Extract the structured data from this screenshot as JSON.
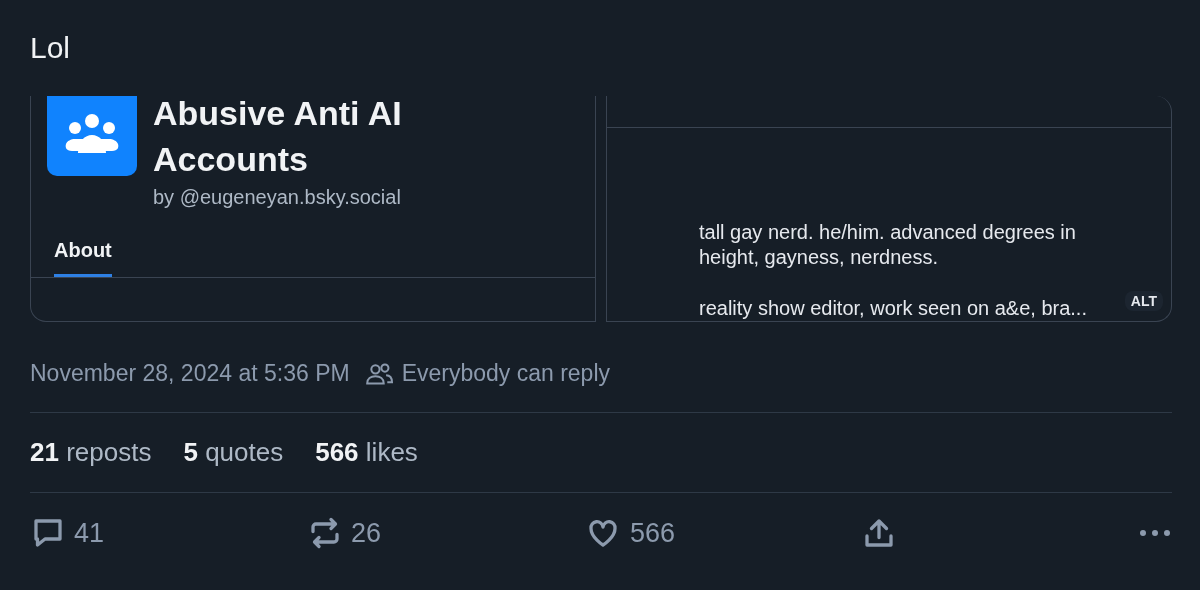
{
  "post": {
    "text": "Lol"
  },
  "images": [
    {
      "kind": "feed",
      "title": "Abusive Anti AI Accounts",
      "author": "by @eugeneyan.bsky.social",
      "tabs": [
        {
          "label": "About",
          "selected": true
        }
      ]
    },
    {
      "kind": "profile",
      "bio": [
        "tall gay nerd. he/him. advanced degrees in height, gayness, nerdness.",
        "reality show editor, work seen on a&e, bra..."
      ],
      "badge": "ALT"
    }
  ],
  "meta": {
    "timestamp": "November 28, 2024 at 5:36 PM",
    "reply_setting": "Everybody can reply"
  },
  "stats": [
    {
      "count": "21",
      "label": "reposts"
    },
    {
      "count": "5",
      "label": "quotes"
    },
    {
      "count": "566",
      "label": "likes"
    }
  ],
  "actions": [
    {
      "kind": "reply",
      "count": "41"
    },
    {
      "kind": "repost",
      "count": "26"
    },
    {
      "kind": "like",
      "count": "566"
    },
    {
      "kind": "share"
    },
    {
      "kind": "more"
    }
  ]
}
